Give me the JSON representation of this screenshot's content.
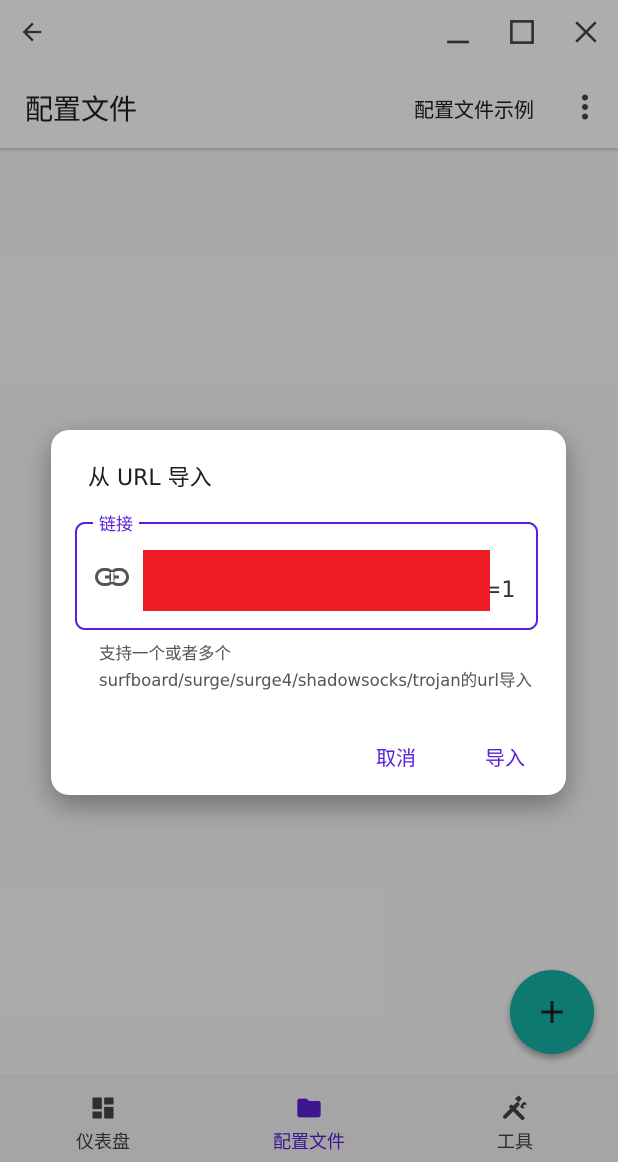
{
  "window": {
    "back_icon": "arrow-left-icon",
    "minimize_icon": "minimize-icon",
    "maximize_icon": "maximize-icon",
    "close_icon": "close-icon"
  },
  "appbar": {
    "title": "配置文件",
    "action": "配置文件示例",
    "more_icon": "more-vert-icon"
  },
  "dialog": {
    "title": "从 URL 导入",
    "field_label": "链接",
    "field_icon": "link-icon",
    "field_value": "",
    "field_value_trailing": "=1",
    "helper": "支持一个或者多个surfboard/surge/surge4/shadowsocks/trojan的url导入",
    "cancel": "取消",
    "confirm": "导入"
  },
  "fab": {
    "icon": "plus-icon"
  },
  "bottom_nav": {
    "items": [
      {
        "label": "仪表盘",
        "icon": "dashboard-icon",
        "active": false
      },
      {
        "label": "配置文件",
        "icon": "folder-icon",
        "active": true
      },
      {
        "label": "工具",
        "icon": "tools-icon",
        "active": false
      }
    ]
  },
  "colors": {
    "accent": "#5b1fd6",
    "fab": "#14b3a6",
    "redaction": "#ee1c25"
  }
}
